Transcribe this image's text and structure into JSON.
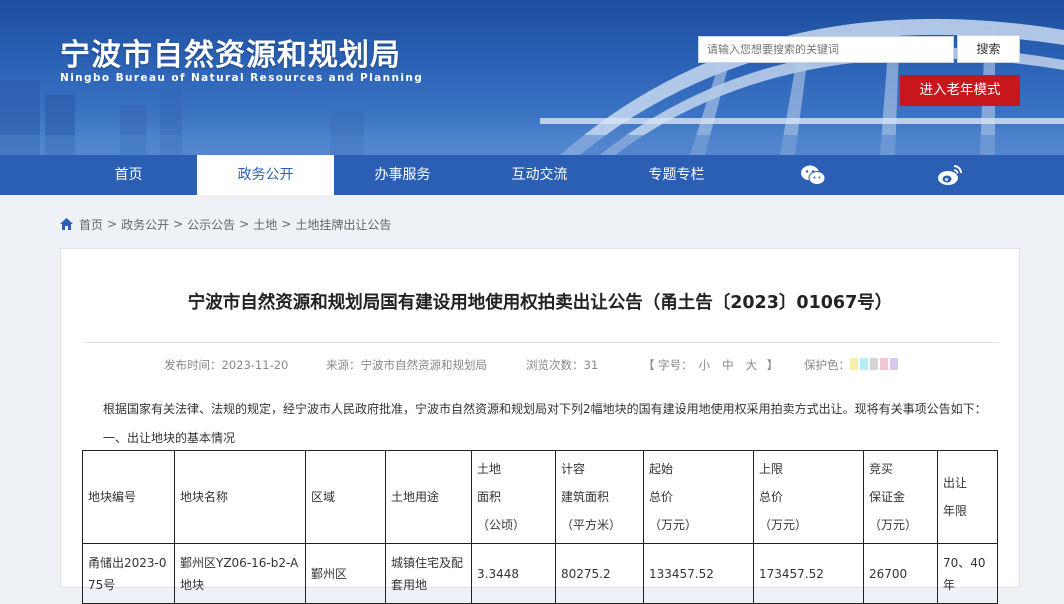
{
  "header": {
    "title": "宁波市自然资源和规划局",
    "subtitle": "Ningbo Bureau of Natural Resources and Planning",
    "search_placeholder": "请输入您想要搜索的关键词",
    "search_button": "搜索",
    "elder_mode_button": "进入老年模式"
  },
  "nav": {
    "items": [
      {
        "label": "首页"
      },
      {
        "label": "政务公开"
      },
      {
        "label": "办事服务"
      },
      {
        "label": "互动交流"
      },
      {
        "label": "专题专栏"
      }
    ],
    "icons": [
      "wechat-icon",
      "weibo-icon"
    ]
  },
  "breadcrumb": [
    "首页",
    "政务公开",
    "公示公告",
    "土地",
    "土地挂牌出让公告"
  ],
  "article": {
    "title": "宁波市自然资源和规划局国有建设用地使用权拍卖出让公告（甬土告〔2023〕01067号）",
    "publish_time": "发布时间：2023-11-20",
    "source": "来源：宁波市自然资源和规划局",
    "views": "浏览次数：31",
    "font_label": "【 字号：",
    "font_small": "小",
    "font_medium": "中",
    "font_large": "大",
    "font_close": " 】",
    "eye_care_label": "保护色：",
    "swatch_colors": [
      "#f7f1a8",
      "#b9ecf5",
      "#d5d5d5",
      "#f3c6d5",
      "#d8c8f2"
    ],
    "intro": "根据国家有关法律、法规的规定，经宁波市人民政府批准，宁波市自然资源和规划局对下列2幅地块的国有建设用地使用权采用拍卖方式出让。现将有关事项公告如下：",
    "section_heading": "一、出让地块的基本情况"
  },
  "table": {
    "headers": [
      "地块编号",
      "地块名称",
      "区域",
      "土地用途",
      "土地\n面积\n（公顷）",
      "计容\n建筑面积\n（平方米）",
      "起始\n总价\n（万元）",
      "上限\n总价\n（万元）",
      "竞买\n保证金\n（万元）",
      "出让\n年限"
    ],
    "rows": [
      [
        "甬储出2023-075号",
        "鄞州区YZ06-16-b2-A地块",
        "鄞州区",
        "城镇住宅及配套用地",
        "3.3448",
        "80275.2",
        "133457.52",
        "173457.52",
        "26700",
        "70、40年"
      ]
    ]
  }
}
